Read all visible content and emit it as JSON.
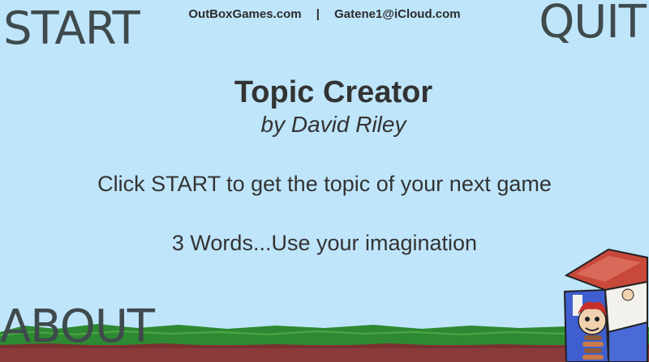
{
  "header": {
    "website": "OutBoxGames.com",
    "separator": "|",
    "email": "Gatene1@iCloud.com"
  },
  "menu": {
    "start_label": "START",
    "quit_label": "QUIT",
    "about_label": "ABOUT"
  },
  "main": {
    "title": "Topic Creator",
    "subtitle": "by David Riley",
    "instruction": "Click START to get the topic of your next game",
    "tagline": "3 Words...Use your imagination"
  },
  "colors": {
    "sky": "#bfe5fb",
    "grass": "#2e8a32",
    "dirt": "#8b3a3a",
    "text": "#333333"
  },
  "icons": {
    "box": "jack-in-the-box-icon"
  }
}
